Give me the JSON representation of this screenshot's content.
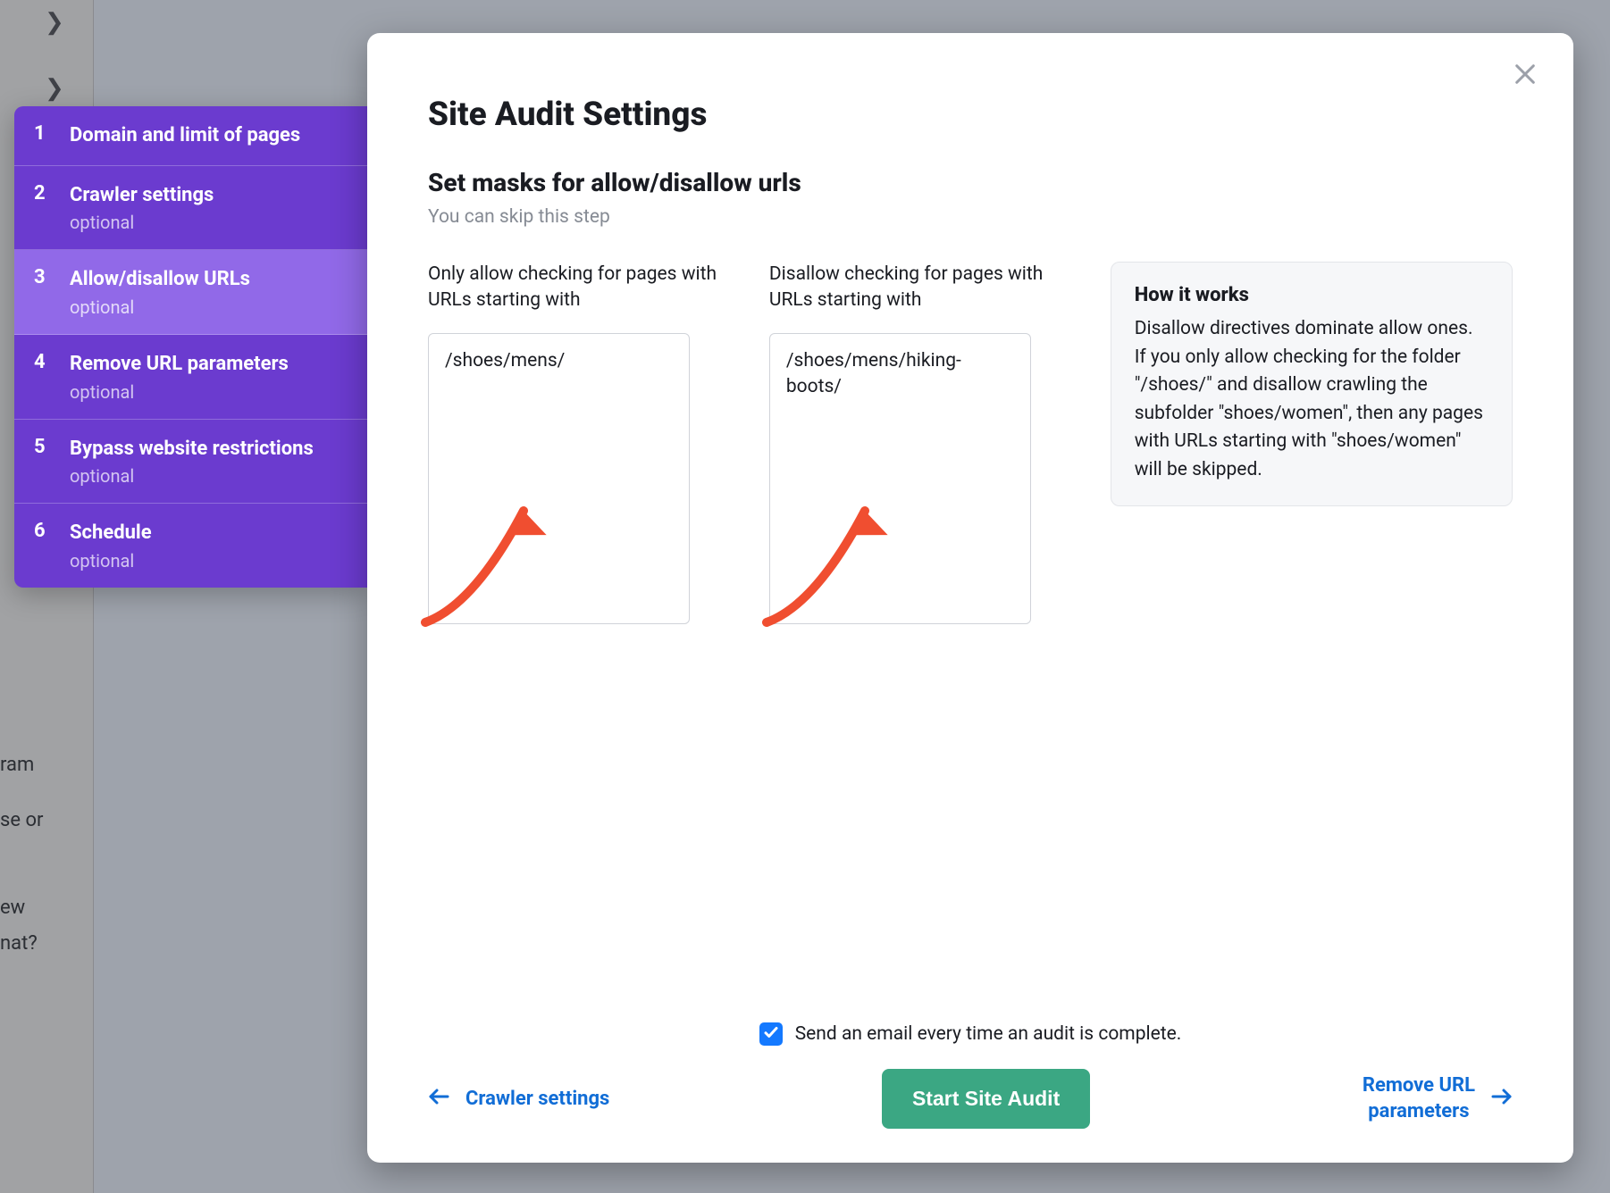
{
  "modal": {
    "title": "Site Audit Settings",
    "subtitle": "Set masks for allow/disallow urls",
    "hint": "You can skip this step",
    "allow_label": "Only allow checking for pages with URLs starting with",
    "allow_value": "/shoes/mens/",
    "disallow_label": "Disallow checking for pages with URLs starting with",
    "disallow_value": "/shoes/mens/hiking-boots/",
    "howitworks_title": "How it works",
    "howitworks_text": "Disallow directives dominate allow ones.\nIf you only allow checking for the folder \"/shoes/\" and disallow crawling the subfolder \"shoes/women\", then any pages with URLs starting with \"shoes/women\" will be skipped."
  },
  "footer": {
    "email_label": "Send an email every time an audit is complete.",
    "prev_label": "Crawler settings",
    "start_label": "Start Site Audit",
    "next_label": "Remove URL parameters"
  },
  "sidebar": {
    "items": [
      {
        "num": "1",
        "label": "Domain and limit of pages",
        "optional": ""
      },
      {
        "num": "2",
        "label": "Crawler settings",
        "optional": "optional"
      },
      {
        "num": "3",
        "label": "Allow/disallow URLs",
        "optional": "optional"
      },
      {
        "num": "4",
        "label": "Remove URL parameters",
        "optional": "optional"
      },
      {
        "num": "5",
        "label": "Bypass website restrictions",
        "optional": "optional"
      },
      {
        "num": "6",
        "label": "Schedule",
        "optional": "optional"
      }
    ]
  },
  "bg": {
    "t1": "ram",
    "t2": "se or",
    "t3": "ew",
    "t4": "nat?"
  }
}
